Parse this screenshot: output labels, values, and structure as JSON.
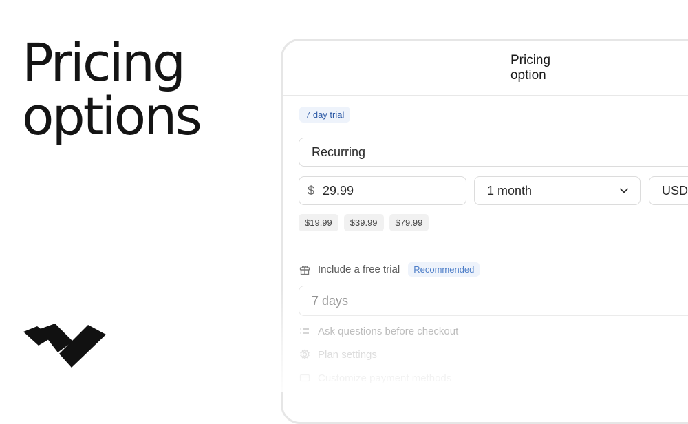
{
  "headline": {
    "line1": "Pricing",
    "line2": "options"
  },
  "panel": {
    "title": "Pricing option",
    "trial_badge": "7 day trial",
    "type_value": "Recurring",
    "price": {
      "currency_symbol": "$",
      "value": "29.99"
    },
    "period": {
      "value": "1 month"
    },
    "currency": {
      "value": "USD"
    },
    "price_chips": [
      "$19.99",
      "$39.99",
      "$79.99"
    ],
    "options": {
      "free_trial_label": "Include a free trial",
      "recommended_badge": "Recommended",
      "trial_days_value": "7 days",
      "ask_questions_label": "Ask questions before checkout",
      "plan_settings_label": "Plan settings",
      "payment_methods_label": "Customize payment methods"
    }
  },
  "colors": {
    "accent": "#2d5aa6",
    "badge_bg": "#eef3fb",
    "logo": "#111111"
  },
  "icons": [
    "brand-logo",
    "chevron-down-icon",
    "gift-icon",
    "list-icon",
    "gear-icon",
    "card-icon"
  ]
}
